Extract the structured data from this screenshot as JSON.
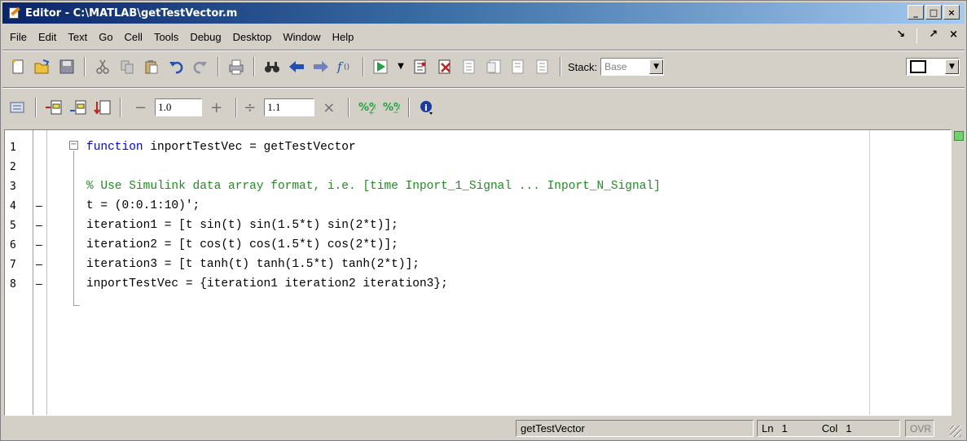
{
  "window": {
    "title": "Editor - C:\\MATLAB\\getTestVector.m",
    "buttons": {
      "minimize": "_",
      "maximize": "□",
      "close": "×"
    }
  },
  "menu": {
    "items": [
      "File",
      "Edit",
      "Text",
      "Go",
      "Cell",
      "Tools",
      "Debug",
      "Desktop",
      "Window",
      "Help"
    ],
    "right": {
      "undock": "↘",
      "close": "×"
    }
  },
  "toolbar1": {
    "icons": [
      "new-file",
      "open-file",
      "save",
      "cut",
      "copy",
      "paste",
      "undo",
      "redo",
      "print",
      "find",
      "back",
      "forward",
      "function-browser",
      "run",
      "run-dropdown",
      "set-breakpoint",
      "clear-breakpoint",
      "step",
      "step-in",
      "step-out",
      "exit-debug"
    ],
    "stack_label": "Stack:",
    "stack_value": "Base"
  },
  "toolbar2": {
    "minus": "−",
    "value1": "1.0",
    "plus": "+",
    "divide": "÷",
    "value2": "1.1",
    "times": "×"
  },
  "editor": {
    "lines": [
      {
        "num": "1",
        "dash": "",
        "parts": [
          {
            "t": "function",
            "c": "kw"
          },
          {
            "t": " inportTestVec = getTestVector",
            "c": ""
          }
        ]
      },
      {
        "num": "2",
        "dash": "",
        "parts": [
          {
            "t": "",
            "c": ""
          }
        ]
      },
      {
        "num": "3",
        "dash": "",
        "parts": [
          {
            "t": "% Use Simulink data array format, i.e. [time Inport_1_Signal ... Inport_N_Signal]",
            "c": "cm"
          }
        ]
      },
      {
        "num": "4",
        "dash": "–",
        "parts": [
          {
            "t": "t = (0:0.1:10)';",
            "c": ""
          }
        ]
      },
      {
        "num": "5",
        "dash": "–",
        "parts": [
          {
            "t": "iteration1 = [t sin(t) sin(1.5*t) sin(2*t)];",
            "c": ""
          }
        ]
      },
      {
        "num": "6",
        "dash": "–",
        "parts": [
          {
            "t": "iteration2 = [t cos(t) cos(1.5*t) cos(2*t)];",
            "c": ""
          }
        ]
      },
      {
        "num": "7",
        "dash": "–",
        "parts": [
          {
            "t": "iteration3 = [t tanh(t) tanh(1.5*t) tanh(2*t)];",
            "c": ""
          }
        ]
      },
      {
        "num": "8",
        "dash": "–",
        "parts": [
          {
            "t": "inportTestVec = {iteration1 iteration2 iteration3};",
            "c": ""
          }
        ]
      }
    ]
  },
  "status": {
    "function_name": "getTestVector",
    "ln_label": "Ln",
    "ln_value": "1",
    "col_label": "Col",
    "col_value": "1",
    "ovr": "OVR"
  },
  "colors": {
    "keyword": "#0000ff",
    "comment": "#228b22",
    "indicator": "#6fd26f"
  }
}
